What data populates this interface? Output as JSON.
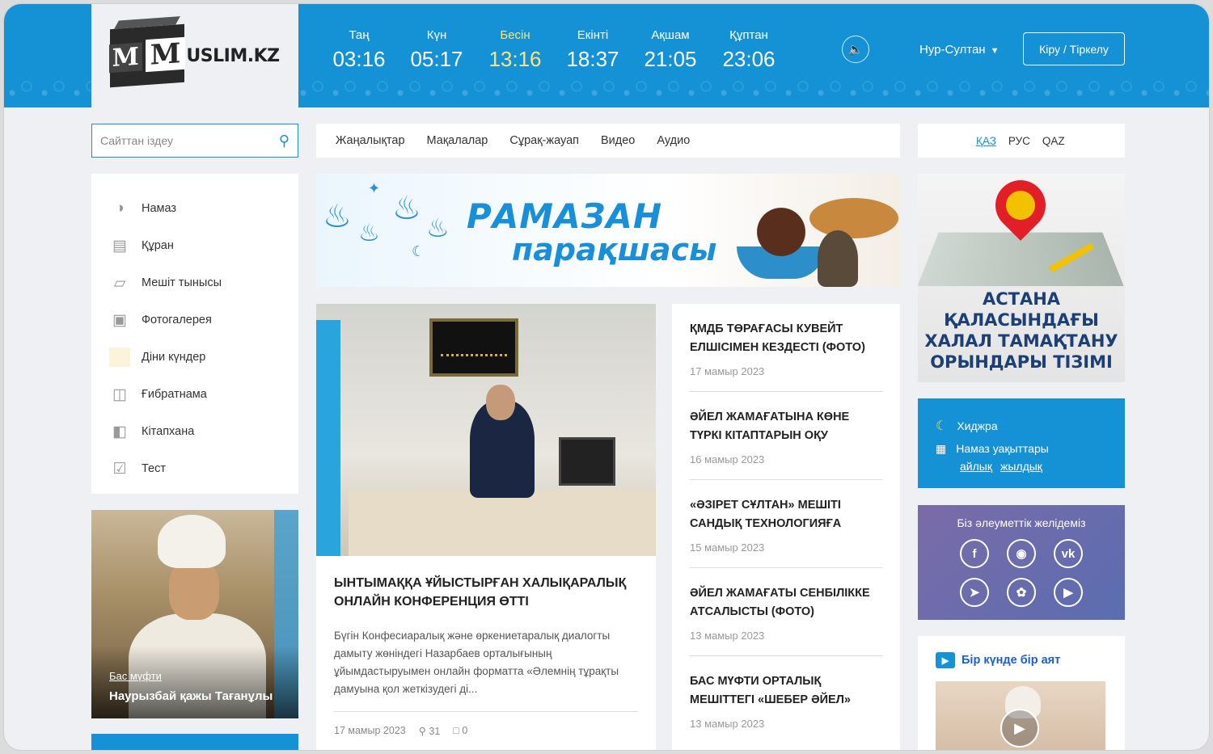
{
  "logo": {
    "text": "USLIM.KZ",
    "m1": "M",
    "m2": "M"
  },
  "prayers": [
    {
      "name": "Таң",
      "time": "03:16"
    },
    {
      "name": "Күн",
      "time": "05:17"
    },
    {
      "name": "Бесін",
      "time": "13:16"
    },
    {
      "name": "Екінті",
      "time": "18:37"
    },
    {
      "name": "Ақшам",
      "time": "21:05"
    },
    {
      "name": "Құптан",
      "time": "23:06"
    }
  ],
  "header": {
    "city": "Нур-Султан",
    "login_label": "Кіру / Тіркелу"
  },
  "search": {
    "placeholder": "Сайттан іздеу"
  },
  "topnav": [
    "Жаңалықтар",
    "Мақалалар",
    "Сұрақ-жауап",
    "Видео",
    "Аудио"
  ],
  "languages": {
    "kaz": "ҚАЗ",
    "rus": "РУС",
    "qaz": "QAZ"
  },
  "sidebar": [
    {
      "label": "Намаз",
      "icon": "prayer-icon"
    },
    {
      "label": "Құран",
      "icon": "quran-icon"
    },
    {
      "label": "Мешіт тынысы",
      "icon": "mosque-icon"
    },
    {
      "label": "Фотогалерея",
      "icon": "gallery-icon"
    },
    {
      "label": "Діни күндер",
      "icon": "calendar-blank-icon"
    },
    {
      "label": "Ғибратнама",
      "icon": "book-icon"
    },
    {
      "label": "Кітапхана",
      "icon": "library-icon"
    },
    {
      "label": "Тест",
      "icon": "checkbox-icon"
    }
  ],
  "mufti": {
    "role": "Бас мүфти",
    "name": "Наурызбай қажы Тағанұлы"
  },
  "banner": {
    "line1": "РАМАЗАН",
    "line2": "парақшасы"
  },
  "featured": {
    "title": "ЫНТЫМАҚҚА ҰЙЫСТЫРҒАН ХАЛЫҚАРАЛЫҚ ОНЛАЙН КОНФЕРЕНЦИЯ ӨТТІ",
    "excerpt": "Бүгін Конфесиаралық және өркениетаралық диалогты дамыту жөніндегі Назарбаев орталығының ұйымдастыруымен онлайн форматта «Әлемнің тұрақты дамуына қол жеткізудегі ді...",
    "date": "17 мамыр 2023",
    "views": "31",
    "comments": "0"
  },
  "news": [
    {
      "title": "ҚМДБ ТӨРАҒАСЫ КУВЕЙТ ЕЛШІСІМЕН КЕЗДЕСТІ (ФОТО)",
      "date": "17 мамыр 2023"
    },
    {
      "title": "ӘЙЕЛ ЖАМАҒАТЫНА КӨНЕ ТҮРКІ КІТАПТАРЫН ОҚУ",
      "date": "16 мамыр 2023"
    },
    {
      "title": "«ӘЗІРЕТ СҰЛТАН» МЕШІТІ САНДЫҚ ТЕХНОЛОГИЯҒА",
      "date": "15 мамыр 2023"
    },
    {
      "title": "ӘЙЕЛ ЖАМАҒАТЫ СЕНБІЛІККЕ АТСАЛЫСТЫ (ФОТО)",
      "date": "13 мамыр 2023"
    },
    {
      "title": "БАС МҮФТИ ОРТАЛЫҚ МЕШІТТЕГІ «ШЕБЕР ӘЙЕЛ»",
      "date": "13 мамыр 2023"
    }
  ],
  "map_ad": {
    "line1": "АСТАНА",
    "line2": "ҚАЛАСЫНДАҒЫ",
    "line3": "ХАЛАЛ ТАМАҚТАНУ",
    "line4": "ОРЫНДАРЫ ТІЗІМІ"
  },
  "hijri": {
    "label": "Хиджра",
    "times_label": "Намаз уақыттары",
    "monthly": "айлық",
    "yearly": "жылдық"
  },
  "social": {
    "title": "Біз әлеуметтік желідеміз"
  },
  "verse": {
    "title": "Бір күнде бір аят"
  },
  "colors": {
    "accent": "#1592d6",
    "active_prayer": "#ffe37a"
  }
}
